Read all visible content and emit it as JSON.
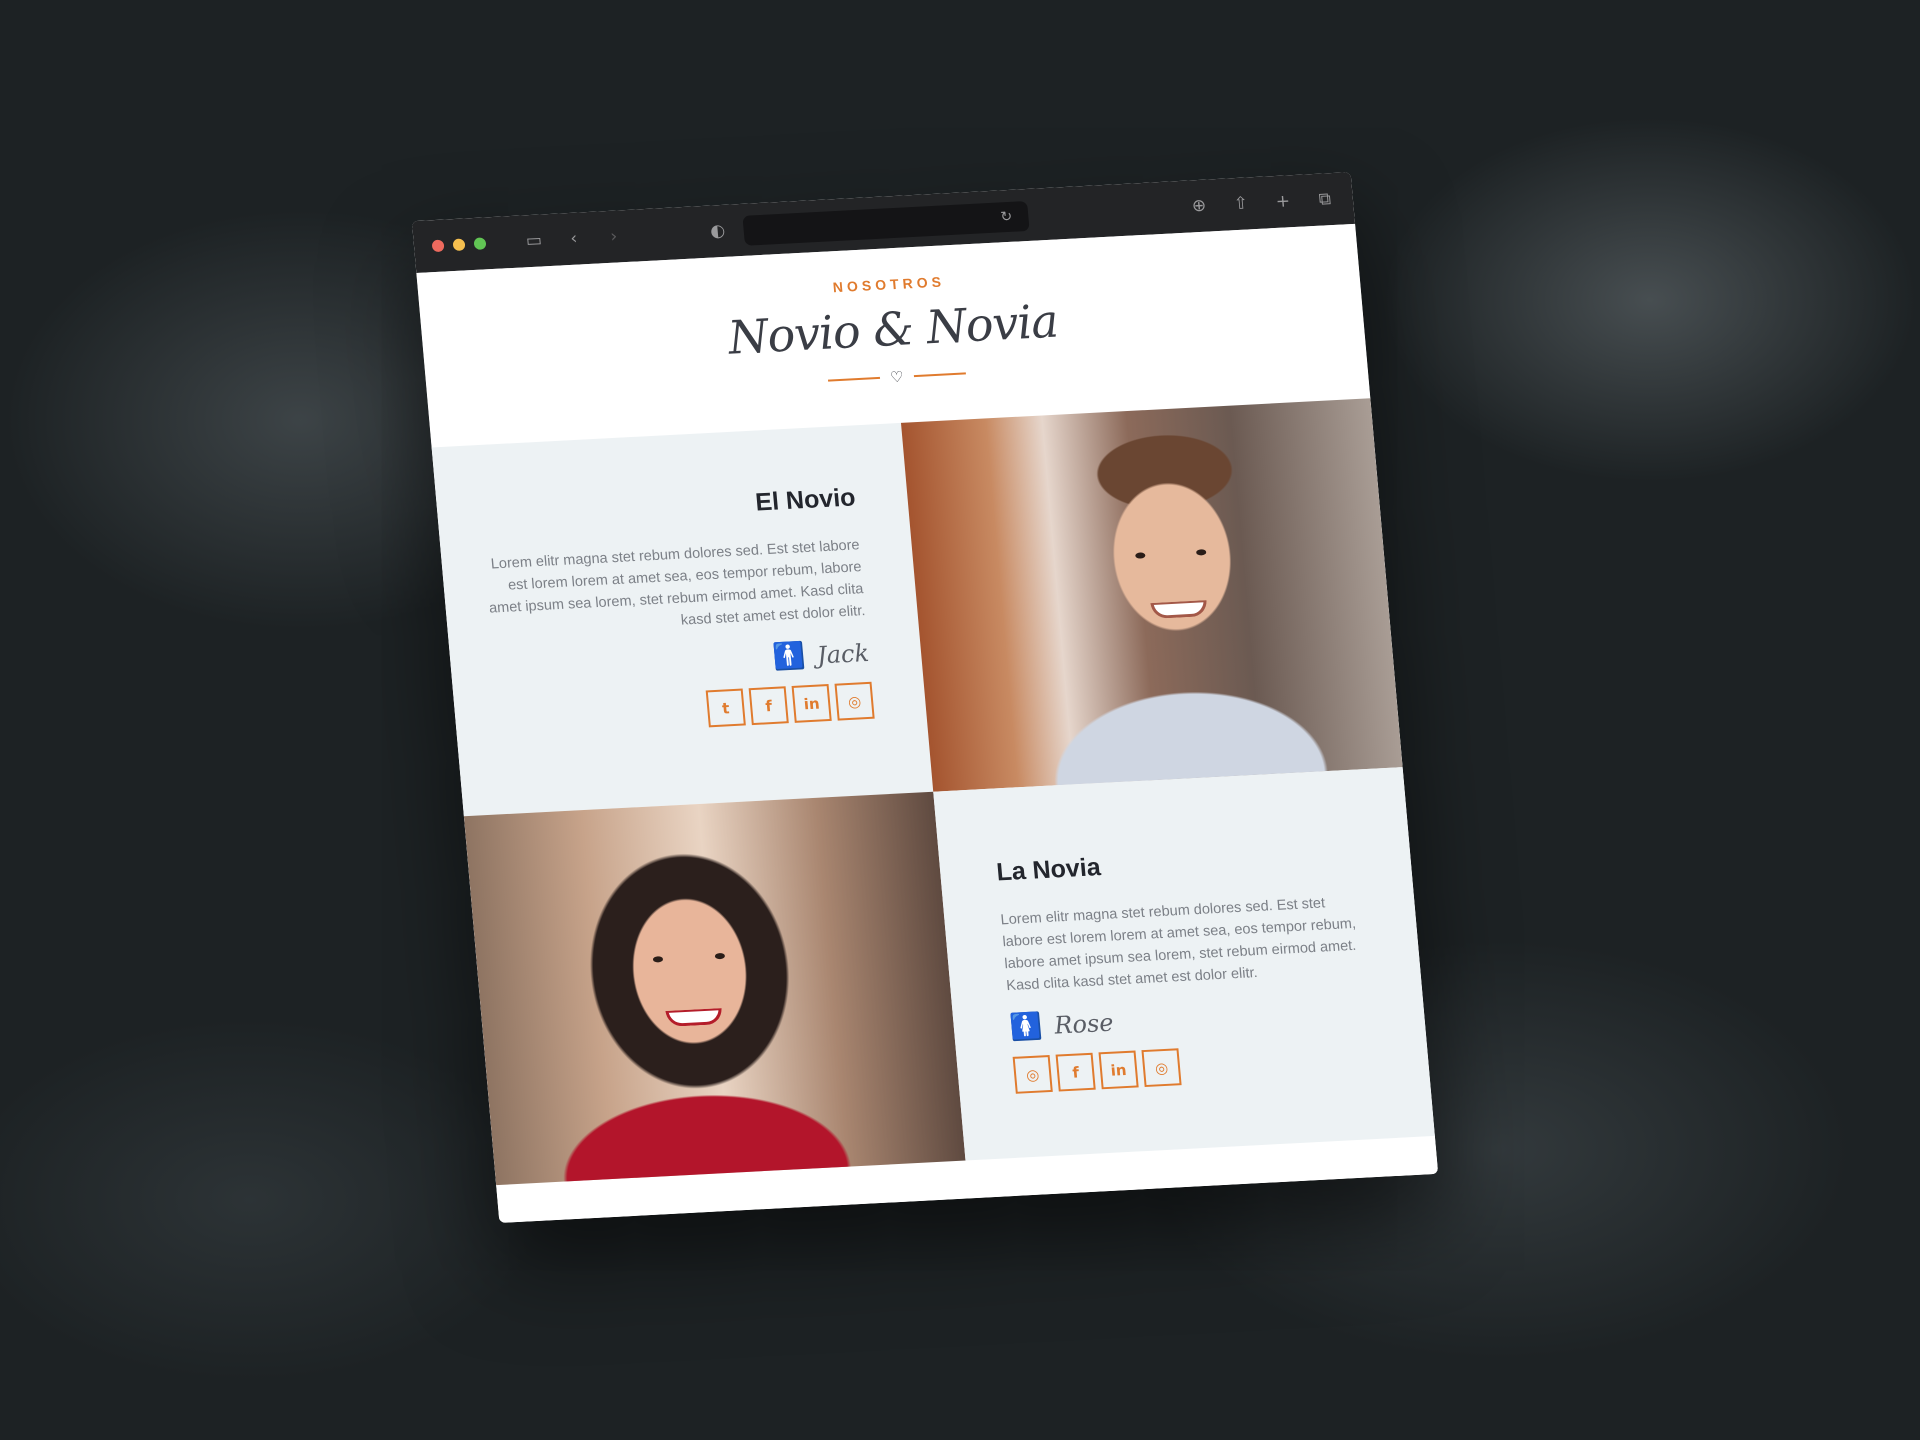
{
  "browser": {
    "icons": {
      "sidebar": "sidebar-icon",
      "back": "back-icon",
      "forward": "forward-icon",
      "shield": "shield-icon",
      "reload": "reload-icon",
      "download": "download-icon",
      "share": "share-icon",
      "new_tab": "plus-icon",
      "tabs": "tabs-overview-icon"
    },
    "url": ""
  },
  "header": {
    "kicker": "NOSOTROS",
    "title": "Novio & Novia"
  },
  "colors": {
    "accent": "#e07b2e",
    "panel_bg": "#edf2f4",
    "heading": "#23262d",
    "body_text": "#7c8087"
  },
  "groom": {
    "heading": "El Novio",
    "bio": "Lorem elitr magna stet rebum dolores sed. Est stet labore est lorem lorem at amet sea, eos tempor rebum, labore amet ipsum sea lorem, stet rebum eirmod amet. Kasd clita kasd stet amet est dolor elitr.",
    "signature": "Jack",
    "socials": [
      {
        "icon": "twitter-icon",
        "glyph": "t"
      },
      {
        "icon": "facebook-icon",
        "glyph": "f"
      },
      {
        "icon": "linkedin-icon",
        "glyph": "in"
      },
      {
        "icon": "instagram-icon",
        "glyph": "◎"
      }
    ]
  },
  "bride": {
    "heading": "La Novia",
    "bio": "Lorem elitr magna stet rebum dolores sed. Est stet labore est lorem lorem at amet sea, eos tempor rebum, labore amet ipsum sea lorem, stet rebum eirmod amet. Kasd clita kasd stet amet est dolor elitr.",
    "signature": "Rose",
    "socials": [
      {
        "icon": "instagram-icon",
        "glyph": "◎"
      },
      {
        "icon": "facebook-icon",
        "glyph": "f"
      },
      {
        "icon": "linkedin-icon",
        "glyph": "in"
      },
      {
        "icon": "instagram-icon",
        "glyph": "◎"
      }
    ]
  }
}
